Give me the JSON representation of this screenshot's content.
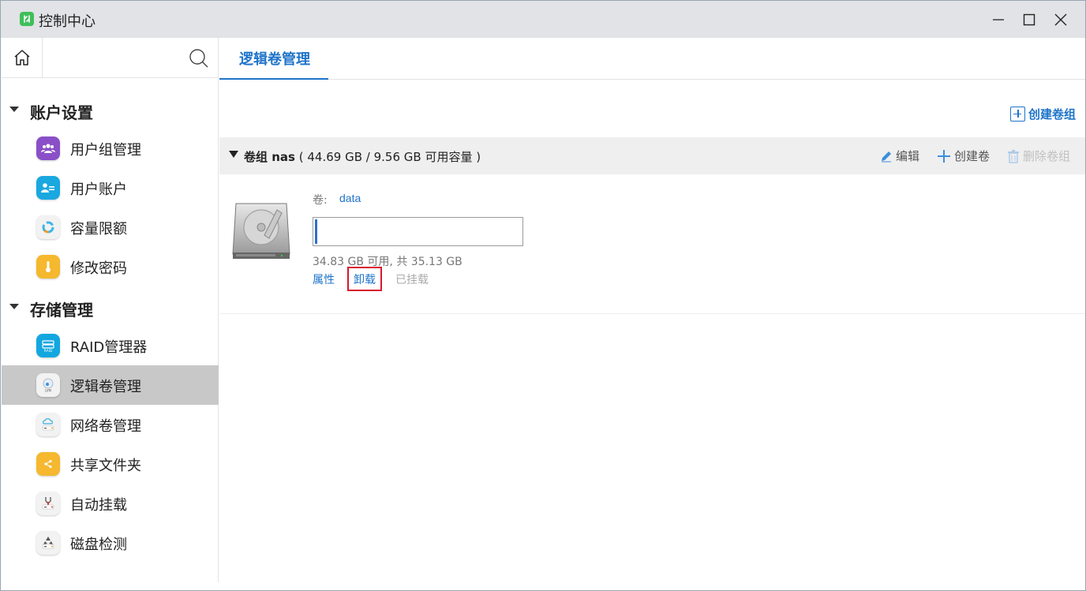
{
  "window": {
    "title": "控制中心",
    "app_icon": "control-center-icon"
  },
  "sidebar": {
    "sections": [
      {
        "label": "账户设置",
        "items": [
          {
            "label": "用户组管理",
            "icon": "user-group-icon",
            "color": "#8a4fc8"
          },
          {
            "label": "用户账户",
            "icon": "user-account-icon",
            "color": "#1aa8e0"
          },
          {
            "label": "容量限额",
            "icon": "quota-icon",
            "color": "#f2f2f2"
          },
          {
            "label": "修改密码",
            "icon": "password-icon",
            "color": "#f5b82e"
          }
        ]
      },
      {
        "label": "存储管理",
        "items": [
          {
            "label": "RAID管理器",
            "icon": "raid-icon",
            "color": "#13a7e0"
          },
          {
            "label": "逻辑卷管理",
            "icon": "lvm-icon",
            "color": "#f2f2f2",
            "active": true
          },
          {
            "label": "网络卷管理",
            "icon": "network-volume-icon",
            "color": "#f2f2f2"
          },
          {
            "label": "共享文件夹",
            "icon": "shared-folder-icon",
            "color": "#f5b82e"
          },
          {
            "label": "自动挂载",
            "icon": "auto-mount-icon",
            "color": "#f2f2f2"
          },
          {
            "label": "磁盘检测",
            "icon": "disk-check-icon",
            "color": "#f2f2f2"
          }
        ]
      }
    ]
  },
  "main": {
    "tab": "逻辑卷管理",
    "create_vg_label": "创建卷组",
    "volume_group": {
      "prefix": "卷组",
      "name": "nas",
      "capacity": "( 44.69 GB / 9.56 GB 可用容量 )",
      "actions": {
        "edit": "编辑",
        "create_volume": "创建卷",
        "delete_group": "删除卷组"
      }
    },
    "volume": {
      "label": "卷:",
      "name": "data",
      "usage_fraction": 0.008,
      "capacity_text": "34.83 GB 可用, 共 35.13 GB",
      "properties": "属性",
      "unmount": "卸载",
      "status": "已挂载"
    }
  },
  "colors": {
    "accent": "#1f74c9",
    "active_nav": "#c8c8c8",
    "highlight_border": "#d9182d"
  }
}
